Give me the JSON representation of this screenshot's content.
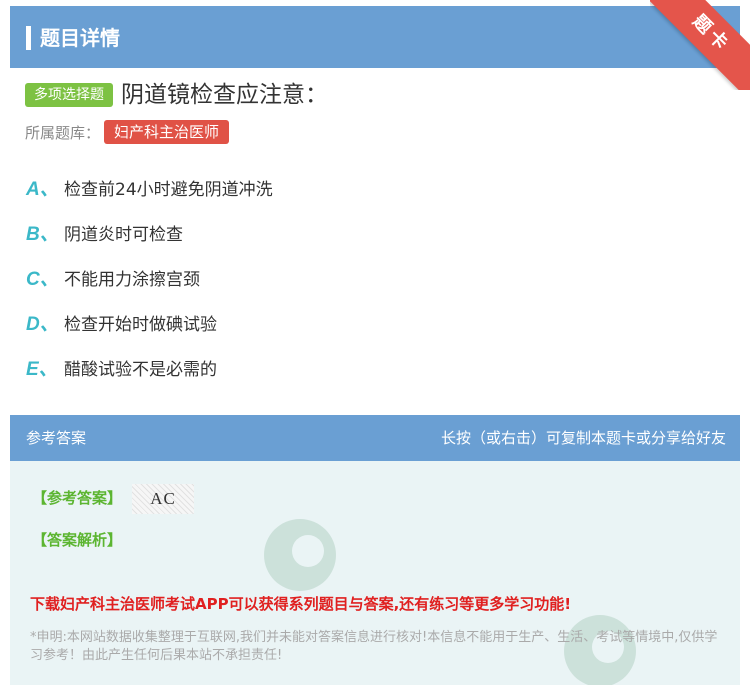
{
  "header": {
    "title": "题目详情"
  },
  "ribbon": {
    "label": "题卡"
  },
  "question": {
    "type_label": "多项选择题",
    "text": "阴道镜检查应注意："
  },
  "bank": {
    "label": "所属题库：",
    "name": "妇产科主治医师"
  },
  "options": [
    {
      "letter": "A、",
      "text": "检查前24小时避免阴道冲洗"
    },
    {
      "letter": "B、",
      "text": "阴道炎时可检查"
    },
    {
      "letter": "C、",
      "text": "不能用力涂擦宫颈"
    },
    {
      "letter": "D、",
      "text": "检查开始时做碘试验"
    },
    {
      "letter": "E、",
      "text": "醋酸试验不是必需的"
    }
  ],
  "answer_section": {
    "title": "参考答案",
    "hint": "长按（或右击）可复制本题卡或分享给好友",
    "answer_label": "【参考答案】",
    "answer_value": "AC",
    "explanation_label": "【答案解析】",
    "promo": "下载妇产科主治医师考试APP可以获得系列题目与答案,还有练习等更多学习功能!",
    "disclaimer": "*申明:本网站数据收集整理于互联网,我们并未能对答案信息进行核对!本信息不能用于生产、生活、考试等情境中,仅供学习参考！由此产生任何后果本站不承担责任!"
  },
  "colors": {
    "header_bg": "#6a9fd3",
    "type_badge": "#7dc243",
    "bank_tag": "#e05246",
    "option_letter": "#3bb8c8",
    "answer_label": "#5cb531",
    "promo": "#e02020"
  }
}
